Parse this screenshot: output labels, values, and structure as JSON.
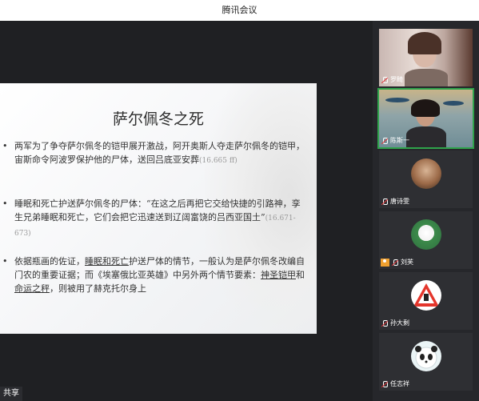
{
  "app": {
    "window_title": "腾讯会议",
    "share_label": "共享"
  },
  "slide": {
    "title": "萨尔佩冬之死",
    "bullets": [
      {
        "a": "两军为了争夺萨尔佩冬的铠甲展开激战，阿开奥斯人夺走萨尔佩冬的铠甲，宙斯命令阿波罗保护他的尸体，送回吕底亚安葬",
        "ref": "(16.665 ff)"
      },
      {
        "a": "睡眠和死亡护送萨尔佩冬的尸体：“在这之后再把它交给快捷的引路神，孪生兄弟睡眠和死亡，它们会把它迅速送到辽阔富饶的吕西亚国土”",
        "ref": "(16.671-673)"
      },
      {
        "a": "依据瓶画的佐证，",
        "u1": "睡眠和死亡",
        "b": "护送尸体的情节，一般认为是萨尔佩冬改编自门农的重要证据；而《埃塞俄比亚英雄》中另外两个情节要素：",
        "u2": "神圣铠甲",
        "c": "和",
        "u3": "命运之秤",
        "d": "，则被用了赫克托尔身上"
      }
    ]
  },
  "participants": [
    {
      "name": "罗畸",
      "muted": true
    },
    {
      "name": "陈斯一",
      "muted": true,
      "active": true
    },
    {
      "name": "唐诗雯",
      "muted": true
    },
    {
      "name": "刘芙",
      "muted": true
    },
    {
      "name": "孙大剩",
      "muted": true
    },
    {
      "name": "任志祥",
      "muted": true
    }
  ],
  "colors": {
    "active_speaker_border": "#2fa34b",
    "mute_slash": "#e5383b"
  }
}
